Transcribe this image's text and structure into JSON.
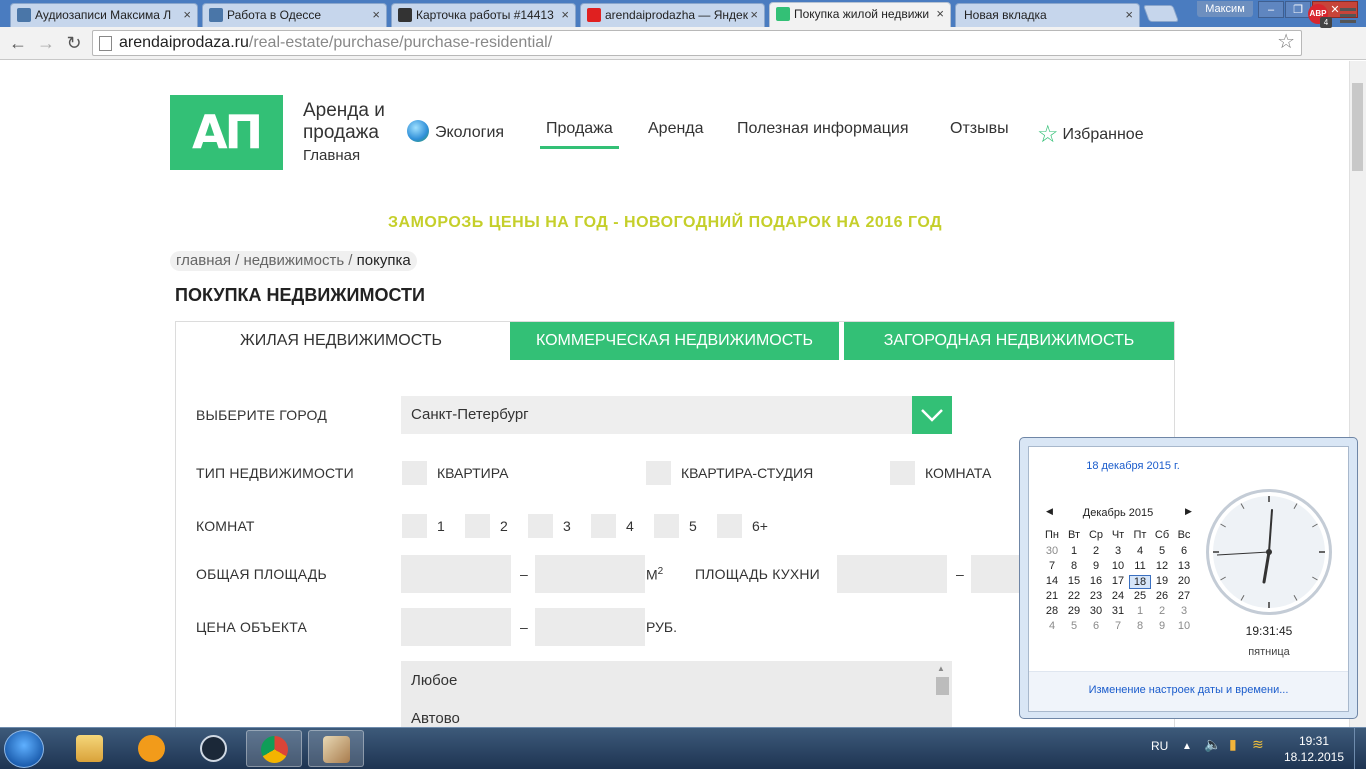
{
  "browser": {
    "tabs": [
      {
        "title": "Аудиозаписи Максима Л",
        "favicon": "vk-audio-icon",
        "color": "#4a76a8"
      },
      {
        "title": "Работа в Одессе",
        "favicon": "vk-icon",
        "color": "#4a76a8"
      },
      {
        "title": "Карточка работы #14413",
        "favicon": "a-icon",
        "color": "#333333"
      },
      {
        "title": "arendaiprodazha — Яндек",
        "favicon": "yandex-icon",
        "color": "#e02020"
      },
      {
        "title": "Покупка жилой недвижи",
        "favicon": "site-icon",
        "color": "#33c076",
        "active": true
      },
      {
        "title": "Новая вкладка",
        "favicon": "",
        "color": ""
      }
    ],
    "user": "Максим",
    "url_host": "arendaiprodaza.ru",
    "url_path": "/real-estate/purchase/purchase-residential/",
    "abp_label": "ABP",
    "abp_count": "4"
  },
  "site": {
    "logo": "АП",
    "brand_title": "Аренда и продажа",
    "brand_sub": "Главная",
    "nav": {
      "ecology": "Экология",
      "sale": "Продажа",
      "rent": "Аренда",
      "info": "Полезная информация",
      "reviews": "Отзывы",
      "favorites": "Избранное"
    },
    "promo": "ЗАМОРОЗЬ ЦЕНЫ НА ГОД - НОВОГОДНИЙ ПОДАРОК НА 2016 ГОД",
    "breadcrumb": {
      "home": "главная",
      "sep": " / ",
      "realty": "недвижимость",
      "current": "покупка"
    },
    "page_title": "ПОКУПКА НЕДВИЖИМОСТИ",
    "tabs": {
      "residential": "ЖИЛАЯ НЕДВИЖИМОСТЬ",
      "commercial": "КОММЕРЧЕСКАЯ НЕДВИЖИМОСТЬ",
      "country": "ЗАГОРОДНАЯ НЕДВИЖИМОСТЬ"
    },
    "form": {
      "city_label": "ВЫБЕРИТЕ ГОРОД",
      "city_value": "Санкт-Петербург",
      "type_label": "ТИП НЕДВИЖИМОСТИ",
      "types": [
        "КВАРТИРА",
        "КВАРТИРА-СТУДИЯ",
        "КОМНАТА"
      ],
      "rooms_label": "КОМНАТ",
      "rooms": [
        "1",
        "2",
        "3",
        "4",
        "5",
        "6+"
      ],
      "area_label": "ОБЩАЯ ПЛОЩАДЬ",
      "dash": "–",
      "area_unit": "М",
      "area_sup": "2",
      "kitchen_label": "ПЛОЩАДЬ КУХНИ",
      "price_label": "ЦЕНА ОБЪЕКТА",
      "price_unit": "РУБ.",
      "list_items": [
        "Любое",
        "Автово"
      ]
    }
  },
  "calendar": {
    "date_long": "18 декабря 2015 г.",
    "month": "Декабрь 2015",
    "weekdays": [
      "Пн",
      "Вт",
      "Ср",
      "Чт",
      "Пт",
      "Сб",
      "Вс"
    ],
    "weeks": [
      [
        "30",
        "1",
        "2",
        "3",
        "4",
        "5",
        "6"
      ],
      [
        "7",
        "8",
        "9",
        "10",
        "11",
        "12",
        "13"
      ],
      [
        "14",
        "15",
        "16",
        "17",
        "18",
        "19",
        "20"
      ],
      [
        "21",
        "22",
        "23",
        "24",
        "25",
        "26",
        "27"
      ],
      [
        "28",
        "29",
        "30",
        "31",
        "1",
        "2",
        "3"
      ],
      [
        "4",
        "5",
        "6",
        "7",
        "8",
        "9",
        "10"
      ]
    ],
    "today": "18",
    "time": "19:31:45",
    "weekday": "пятница",
    "settings_link": "Изменение настроек даты и времени..."
  },
  "taskbar": {
    "lang": "RU",
    "clock_time": "19:31",
    "clock_date": "18.12.2015"
  },
  "colors": {
    "accent": "#33c076",
    "promo": "#c5cf2a",
    "link": "#1a5ccc"
  }
}
